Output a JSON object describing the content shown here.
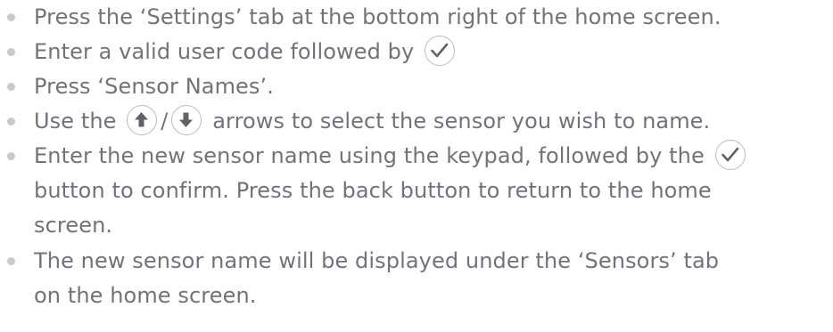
{
  "instructions": {
    "step1": "Press the ‘Settings’ tab at the bottom right of the home screen.",
    "step2": "Enter a valid user code followed by",
    "step3": "Press ‘Sensor Names’.",
    "step4_before": "Use the",
    "step4_sep": "/",
    "step4_after": "arrows to select the sensor you wish to name.",
    "step5_line1": "Enter the new sensor name using the keypad, followed by the",
    "step5_line2": "button to confirm. Press the back button to return to the home",
    "step5_line3": "screen.",
    "step6_line1": "The new sensor name will be displayed under the ‘Sensors’ tab",
    "step6_line2": "on the home screen."
  },
  "icons": {
    "confirm": "check-icon",
    "up": "arrow-up-icon",
    "down": "arrow-down-icon"
  },
  "colors": {
    "text": "#707478",
    "bullet": "#c8cacc",
    "icon_border": "#b9bcbf",
    "check": "#5f6368",
    "arrow": "#5f6368"
  }
}
